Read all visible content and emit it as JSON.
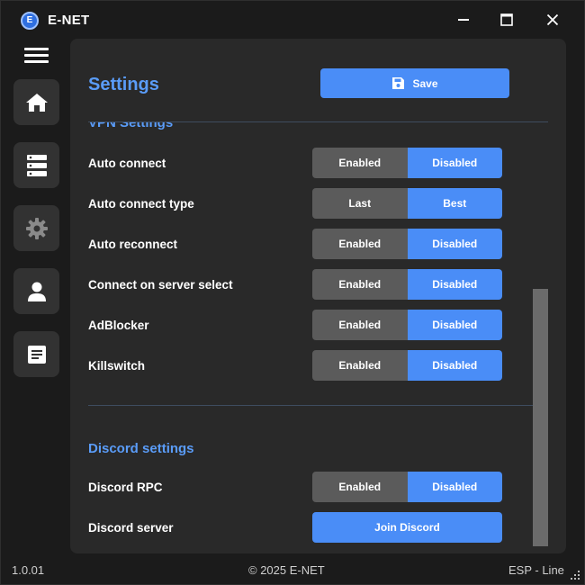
{
  "app": {
    "title": "E-NET",
    "logo_letter": "E",
    "accent_color": "#4a8df7"
  },
  "window_controls": {
    "minimize_icon": "minimize-icon",
    "maximize_icon": "maximize-icon",
    "close_icon": "close-icon"
  },
  "sidebar": {
    "menu_icon": "hamburger-menu-icon",
    "items": [
      {
        "icon": "home-icon"
      },
      {
        "icon": "server-list-icon"
      },
      {
        "icon": "gear-icon"
      },
      {
        "icon": "user-icon"
      },
      {
        "icon": "document-icon"
      }
    ]
  },
  "settings": {
    "title": "Settings",
    "save_label": "Save",
    "save_icon": "floppy-disk-icon",
    "vpn_section_title": "VPN Settings",
    "vpn_rows": [
      {
        "label": "Auto connect",
        "option_a": "Enabled",
        "option_b": "Disabled",
        "selected": "option_b"
      },
      {
        "label": "Auto connect type",
        "option_a": "Last",
        "option_b": "Best",
        "selected": "option_b"
      },
      {
        "label": "Auto reconnect",
        "option_a": "Enabled",
        "option_b": "Disabled",
        "selected": "option_b"
      },
      {
        "label": "Connect on server select",
        "option_a": "Enabled",
        "option_b": "Disabled",
        "selected": "option_b"
      },
      {
        "label": "AdBlocker",
        "option_a": "Enabled",
        "option_b": "Disabled",
        "selected": "option_b"
      },
      {
        "label": "Killswitch",
        "option_a": "Enabled",
        "option_b": "Disabled",
        "selected": "option_b"
      }
    ],
    "discord_section_title": "Discord settings",
    "discord_rpc": {
      "label": "Discord RPC",
      "option_a": "Enabled",
      "option_b": "Disabled",
      "selected": "option_b"
    },
    "discord_server": {
      "label": "Discord server",
      "button_label": "Join Discord"
    }
  },
  "footer": {
    "version": "1.0.01",
    "copyright": "© 2025 E-NET",
    "locale": "ESP - Line"
  }
}
